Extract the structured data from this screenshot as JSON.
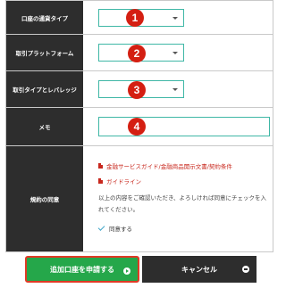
{
  "form": {
    "account_type": {
      "label": "口座の通貨タイプ",
      "badge": "❶"
    },
    "platform": {
      "label": "取引プラットフォーム",
      "badge": "❷"
    },
    "leverage": {
      "label": "取引タイプとレバレッジ",
      "badge": "❸"
    },
    "memo": {
      "label": "メモ",
      "badge": "❹"
    },
    "terms": {
      "label": "規約の同意",
      "docs": [
        "金融サービスガイド/金融商品開示文書/契約条件",
        "ガイドライン"
      ],
      "notice": "以上の内容をご確認いただき、よろしければ同意にチェックを入れてください。",
      "agree_label": "同意する"
    }
  },
  "buttons": {
    "apply_label": "追加口座を申請する",
    "cancel_label": "キャンセル"
  },
  "colors": {
    "label_bg": "#2d2d2d",
    "badge": "#d41f12",
    "input_border": "#3fb7a6",
    "apply_bg": "#25a74a",
    "link": "#c8281e"
  }
}
